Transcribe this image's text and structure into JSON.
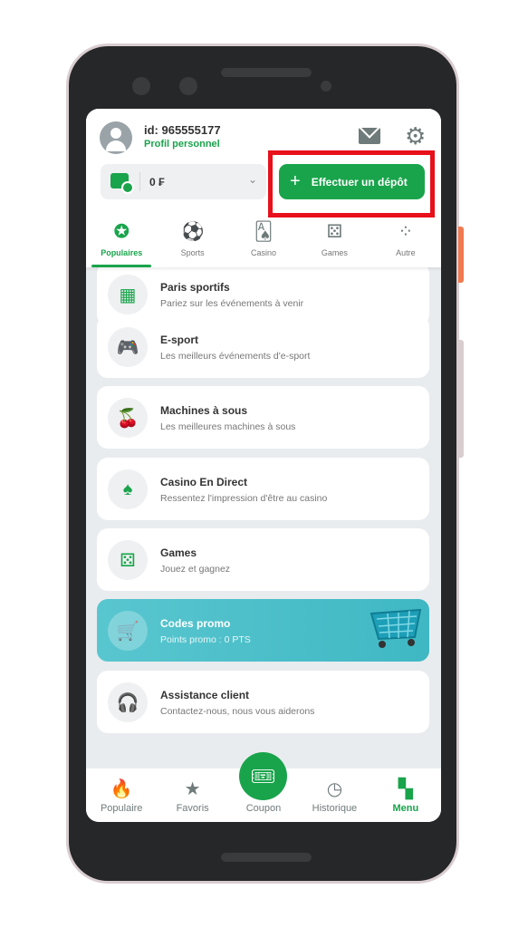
{
  "header": {
    "user_id": "id: 965555177",
    "profile_label": "Profil personnel",
    "balance": "0 ₣",
    "deposit_label": "Effectuer un dépôt"
  },
  "tabs": [
    {
      "label": "Populaires",
      "icon": "star-badge-icon",
      "active": true
    },
    {
      "label": "Sports",
      "icon": "soccer-ball-icon"
    },
    {
      "label": "Casino",
      "icon": "cards-icon"
    },
    {
      "label": "Games",
      "icon": "dice-icon"
    },
    {
      "label": "Autre",
      "icon": "bubbles-icon"
    }
  ],
  "menu": [
    {
      "title": "Paris sportifs",
      "subtitle": "Pariez sur les événements à venir",
      "icon": "calendar-icon"
    },
    {
      "title": "E-sport",
      "subtitle": "Les meilleurs événements d'e-sport",
      "icon": "gamepad-icon"
    },
    {
      "title": "Machines à sous",
      "subtitle": "Les meilleures machines à sous",
      "icon": "cherry-icon"
    },
    {
      "title": "Casino En Direct",
      "subtitle": "Ressentez l'impression d'être au casino",
      "icon": "spade-icon"
    },
    {
      "title": "Games",
      "subtitle": "Jouez et gagnez",
      "icon": "dice-icon"
    },
    {
      "title": "Codes promo",
      "subtitle": "Points promo : 0 PTS",
      "icon": "cart-icon"
    },
    {
      "title": "Assistance client",
      "subtitle": "Contactez-nous, nous vous aiderons",
      "icon": "headset-icon"
    }
  ],
  "bottom_nav": [
    {
      "label": "Populaire",
      "icon": "flame-icon"
    },
    {
      "label": "Favoris",
      "icon": "star-icon"
    },
    {
      "label": "Coupon",
      "icon": "ticket-icon"
    },
    {
      "label": "Historique",
      "icon": "clock-icon"
    },
    {
      "label": "Menu",
      "icon": "grid-icon",
      "active": true
    }
  ],
  "colors": {
    "accent": "#19a44b",
    "highlight": "#e8101a",
    "promo": "#4cbfca"
  }
}
